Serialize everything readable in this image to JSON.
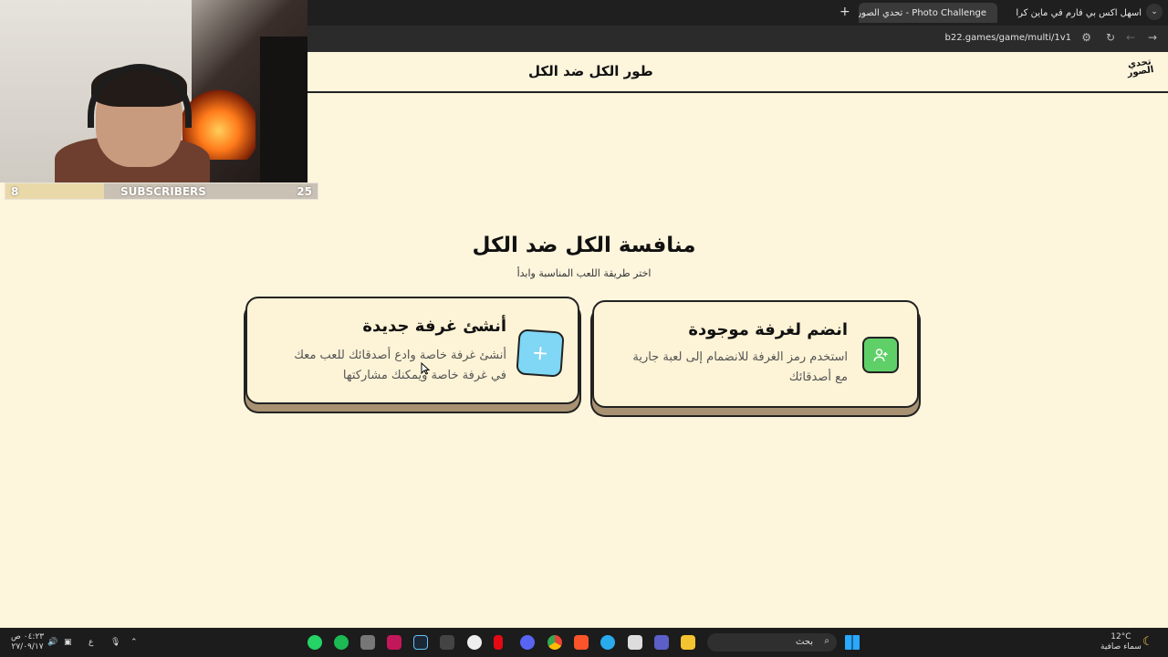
{
  "browser": {
    "tabs": [
      {
        "title": "اسهل اكس بي فارم في ماين كرافت"
      },
      {
        "title": "Photo Challenge - تحدي الصور"
      }
    ],
    "new_tab": "+",
    "url": "b22.games/game/multi/1v1"
  },
  "stream_overlay": {
    "subscribers_label": "SUBSCRIBERS",
    "current": "8",
    "goal": "25",
    "progress_fraction": 0.32
  },
  "site": {
    "logo_text": "تحدي الصور",
    "header_title": "طور الكل ضد الكل"
  },
  "main": {
    "title": "منافسة الكل ضد الكل",
    "subtitle": "اختر طريقة اللعب المناسبة وابدأ",
    "create_card": {
      "title": "أنشئ غرفة جديدة",
      "description": "أنشئ غرفة خاصة وادع أصدقائك للعب معك في غرفة خاصة ويمكنك مشاركتها",
      "icon": "plus-icon",
      "icon_color": "#7fd6f5"
    },
    "join_card": {
      "title": "انضم لغرفة موجودة",
      "description": "استخدم رمز الغرفة للانضمام إلى لعبة جارية مع أصدقائك",
      "icon": "user-plus-icon",
      "icon_color": "#5fd068"
    }
  },
  "taskbar": {
    "search_placeholder": "بحث",
    "weather_temp": "12°C",
    "weather_desc": "سماء صافية",
    "time": "٠٤:٢٣ ص",
    "date": "٢٧/٠٩/١٧",
    "lang": "ع"
  }
}
